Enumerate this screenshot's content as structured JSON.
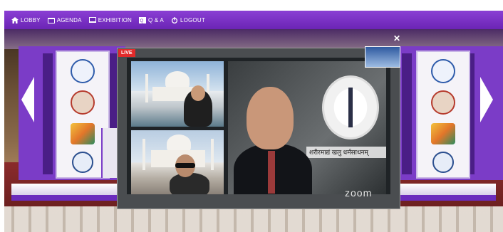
{
  "nav": {
    "items": [
      {
        "label": "LOBBY",
        "icon": "home-icon"
      },
      {
        "label": "AGENDA",
        "icon": "calendar-icon"
      },
      {
        "label": "EXHIBITION",
        "icon": "exhibition-icon"
      },
      {
        "label": "Q & A",
        "icon": "qa-icon"
      },
      {
        "label": "LOGOUT",
        "icon": "power-icon"
      }
    ]
  },
  "video": {
    "live_label": "LIVE",
    "watermark": "zoom",
    "emblem_text": "शरीरमाद्यं खलु धर्मसाधनम्"
  },
  "colors": {
    "nav_bg": "#7a34c8",
    "brand_purple": "#7b3cc7",
    "live_red": "#e22b2b"
  }
}
